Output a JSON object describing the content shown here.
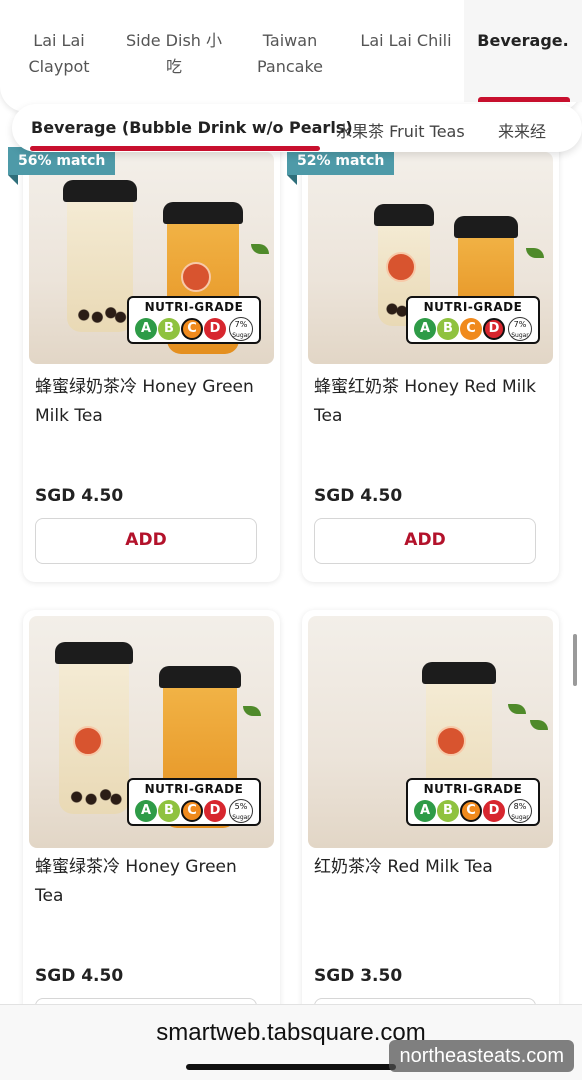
{
  "categories": [
    "Lai Lai\nClaypot",
    "Side Dish 小\n吃",
    "Taiwan\nPancake",
    "Lai Lai Chili",
    "Beverage."
  ],
  "sub_categories": [
    "Beverage (Bubble Drink w/o Pearls)",
    "水果茶 Fruit Teas",
    "来来经"
  ],
  "nutri_label": "NUTRI-GRADE",
  "grades": [
    "A",
    "B",
    "C",
    "D"
  ],
  "grade_colors": [
    "#2e9b47",
    "#8fc23f",
    "#f08a1d",
    "#d7262e"
  ],
  "sugar_unit": "Sugar",
  "add_label": "ADD",
  "products": [
    {
      "name": "蜂蜜绿奶茶冷 Honey Green Milk Tea",
      "price": "SGD 4.50",
      "match": "56% match",
      "sugar": "7%",
      "grade": "C"
    },
    {
      "name": "蜂蜜红奶茶 Honey Red Milk Tea",
      "price": "SGD 4.50",
      "match": "52% match",
      "sugar": "7%",
      "grade": "D"
    },
    {
      "name": "蜂蜜绿茶冷 Honey Green Tea",
      "price": "SGD 4.50",
      "match": "",
      "sugar": "5%",
      "grade": "C"
    },
    {
      "name": "红奶茶冷 Red Milk Tea",
      "price": "SGD 3.50",
      "match": "",
      "sugar": "8%",
      "grade": "C"
    }
  ],
  "browser": {
    "url": "smartweb.tabsquare.com"
  },
  "watermark": "northeasteats.com"
}
